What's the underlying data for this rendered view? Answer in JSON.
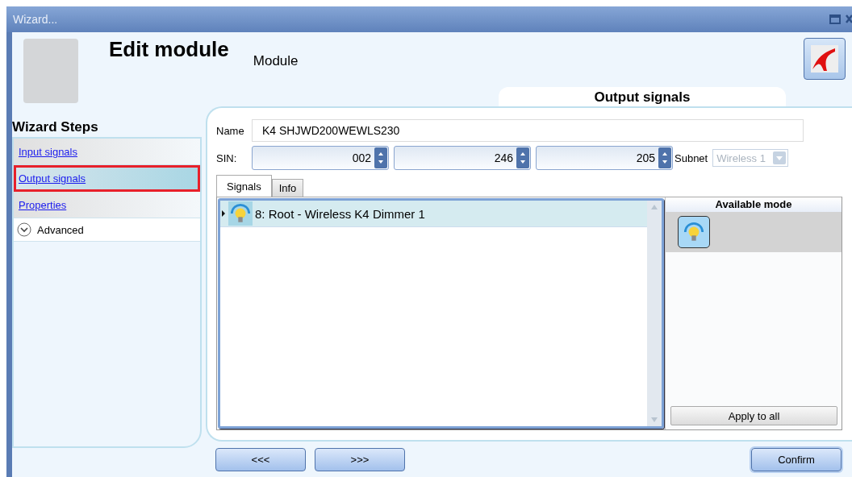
{
  "window": {
    "title": "Wizard..."
  },
  "header": {
    "title": "Edit module",
    "subtitle": "Module"
  },
  "wizard_steps": {
    "title": "Wizard Steps",
    "items": [
      {
        "label": "Input signals",
        "selected": false
      },
      {
        "label": "Output signals",
        "selected": true
      },
      {
        "label": "Properties",
        "selected": false
      }
    ],
    "advanced": {
      "label": "Advanced",
      "expanded": false
    }
  },
  "panel": {
    "title": "Output signals",
    "name": {
      "label": "Name",
      "value": "K4 SHJWD200WEWLS230"
    },
    "sin": {
      "label": "SIN:",
      "values": [
        "002",
        "246",
        "205"
      ]
    },
    "subnet": {
      "label": "Subnet",
      "value": "Wireless 1",
      "disabled": true
    },
    "tabs": [
      {
        "label": "Signals",
        "selected": true
      },
      {
        "label": "Info",
        "selected": false
      }
    ],
    "signals": [
      {
        "label": "8: Root - Wireless K4 Dimmer 1",
        "kind": "dimmer",
        "selected": true
      }
    ],
    "available_mode": {
      "title": "Available mode",
      "modes": [
        {
          "kind": "dimmer",
          "selected": true
        }
      ],
      "apply_button": "Apply to all"
    }
  },
  "footer": {
    "back": "<<<",
    "next": ">>>",
    "confirm": "Confirm"
  }
}
